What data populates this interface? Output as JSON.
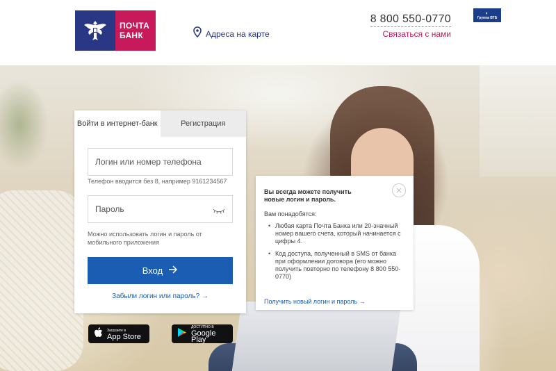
{
  "header": {
    "logo_line1": "ПОЧТА",
    "logo_line2": "БАНК",
    "map_link": "Адреса на карте",
    "phone": "8 800 550-0770",
    "contact": "Связаться с нами",
    "vtb_badge": "Группа ВТБ"
  },
  "login": {
    "tabs": [
      {
        "label": "Войти в интернет-банк",
        "active": true
      },
      {
        "label": "Регистрация",
        "active": false
      }
    ],
    "login_placeholder": "Логин или номер телефона",
    "login_hint": "Телефон вводится без 8, например 9161234567",
    "password_placeholder": "Пароль",
    "password_hint": "Можно использовать логин и пароль от мобильного приложения",
    "submit_label": "Вход",
    "forgot_link": "Забыли логин или пароль?"
  },
  "info": {
    "title": "Вы всегда можете получить новые логин и пароль.",
    "need": "Вам понадобятся:",
    "items": [
      "Любая карта Почта Банка или 20-значный номер вашего счета, который начинается с цифры 4.",
      "Код доступа, полученный в SMS от банка при оформлении договора (его можно получить повторно по телефону 8 800 550-0770)"
    ],
    "link": "Получить новый логин и пароль"
  },
  "stores": {
    "apple_small": "Загрузите в",
    "apple_big": "App Store",
    "google_small": "ДОСТУПНО В",
    "google_big": "Google Play"
  },
  "colors": {
    "brand_blue": "#2a3784",
    "brand_red": "#c8195a",
    "button_blue": "#1a5db3"
  }
}
